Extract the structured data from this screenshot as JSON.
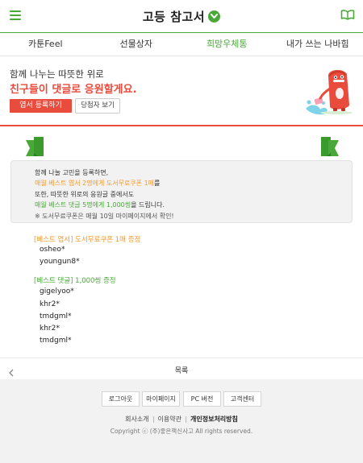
{
  "header": {
    "title": "고등 참고서",
    "menu_icon": "hamburger-menu-icon",
    "right_icon": "book-icon",
    "accent_color": "#4aa83a"
  },
  "tabs": [
    {
      "label": "카툰Feel",
      "active": false
    },
    {
      "label": "선물상자",
      "active": false
    },
    {
      "label": "희망우체통",
      "active": true
    },
    {
      "label": "내가 쓰는 나바힘",
      "active": false
    }
  ],
  "hero": {
    "line1": "함께 나누는 따뜻한 위로",
    "line2": "친구들이 댓글로 응원할게요.",
    "register_button": "엽서 등록하기",
    "winners_button": "당첨자 보기",
    "highlight_color": "#e94b3c"
  },
  "notice": {
    "line1": "함께 나눌 고민을 등록하면,",
    "line2": "매월 베스트 엽서 2명에게 도서무료쿠폰 1매를",
    "line2_orange": "매월 베스트 엽서 2명에게 도서무료쿠폰 1매",
    "line2_rest": "를",
    "line3": "또한, 따뜻한 위로의 응원글 중에서도",
    "line4_green": "매월 베스트 댓글 5명에게 1,000씽",
    "line4_rest": "을 드립니다.",
    "line5": "※ 도서무료쿠폰은 매월 10일 마이페이지에서 확인!"
  },
  "winners": {
    "postcard_title": "[베스트 엽서] 도서무료쿠폰 1매 증정",
    "postcard_winners": [
      "osheo*",
      "youngun8*"
    ],
    "comment_title": "[베스트 댓글] 1,000씽 증정",
    "comment_winners": [
      "gigelyoo*",
      "khr2*",
      "tmdgml*",
      "khr2*",
      "tmdgml*"
    ]
  },
  "list_nav": {
    "label": "목록",
    "back_icon": "chevron-left-icon"
  },
  "footer": {
    "buttons": [
      "로그아웃",
      "마이페이지",
      "PC 버전",
      "고객센터"
    ],
    "links": [
      "회사소개",
      "이용약관",
      "개인정보처리방침"
    ],
    "copyright": "Copyright ⓒ (주)좋은책신사고 All rights reserved."
  }
}
